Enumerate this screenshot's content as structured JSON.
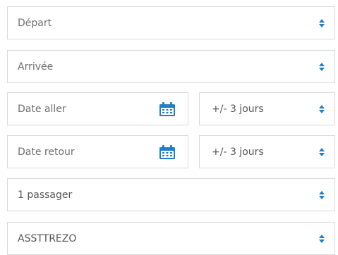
{
  "form": {
    "departure": {
      "label": "Départ",
      "icon": "select-arrows-icon"
    },
    "arrival": {
      "label": "Arrivée",
      "icon": "select-arrows-icon"
    },
    "outbound_date": {
      "placeholder": "Date aller",
      "icon": "calendar-icon"
    },
    "outbound_flex": {
      "value": "+/- 3 jours",
      "icon": "select-arrows-icon"
    },
    "return_date": {
      "placeholder": "Date retour",
      "icon": "calendar-icon"
    },
    "return_flex": {
      "value": "+/- 3 jours",
      "icon": "select-arrows-icon"
    },
    "passengers": {
      "value": "1 passager",
      "icon": "select-arrows-icon"
    },
    "card": {
      "value": "ASSTTREZO",
      "icon": "select-arrows-icon"
    }
  },
  "colors": {
    "accent": "#1f7fc6",
    "border": "#d9d9d9",
    "text": "#6e6e6e"
  }
}
